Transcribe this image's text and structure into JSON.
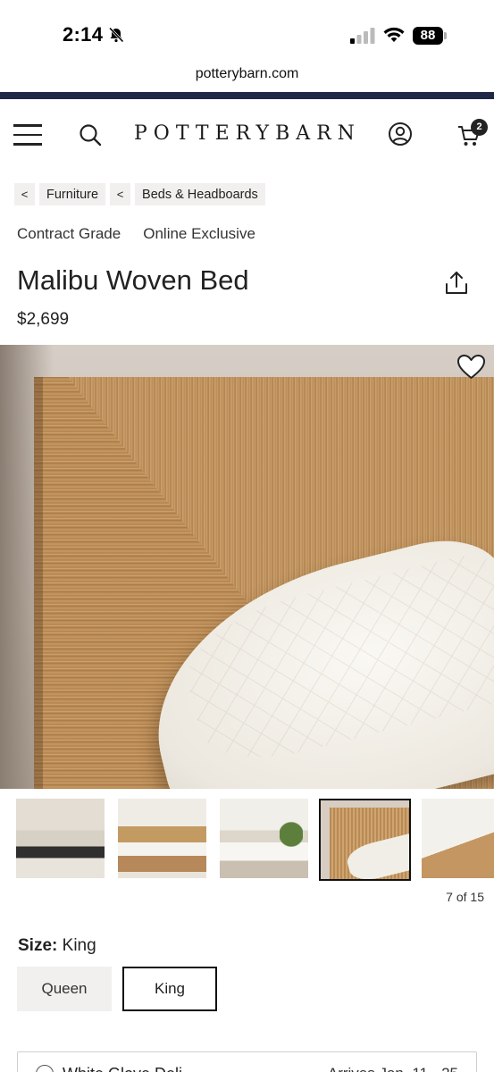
{
  "status_bar": {
    "time": "2:14",
    "battery": "88"
  },
  "browser": {
    "url": "potterybarn.com"
  },
  "header": {
    "logo": "POTTERYBARN",
    "cart_count": "2",
    "icons": [
      "hamburger-icon",
      "search-icon",
      "account-icon",
      "cart-icon"
    ]
  },
  "breadcrumb": {
    "chevron": "<",
    "items": [
      "Furniture",
      "Beds & Headboards"
    ]
  },
  "tags": [
    "Contract Grade",
    "Online Exclusive"
  ],
  "product": {
    "title": "Malibu Woven Bed",
    "price": "$2,699"
  },
  "gallery": {
    "counter": "7 of 15",
    "thumbnail_count": 5,
    "active_index": 3
  },
  "size": {
    "label": "Size:",
    "selected_value": "King",
    "options": [
      "Queen",
      "King"
    ]
  },
  "delivery": {
    "name": "White Glove Deli",
    "date": "Arrives Jan. 11 - 25"
  },
  "colors": {
    "accent_bar": "#1f2746",
    "chip_bg": "#f1f0ee"
  }
}
